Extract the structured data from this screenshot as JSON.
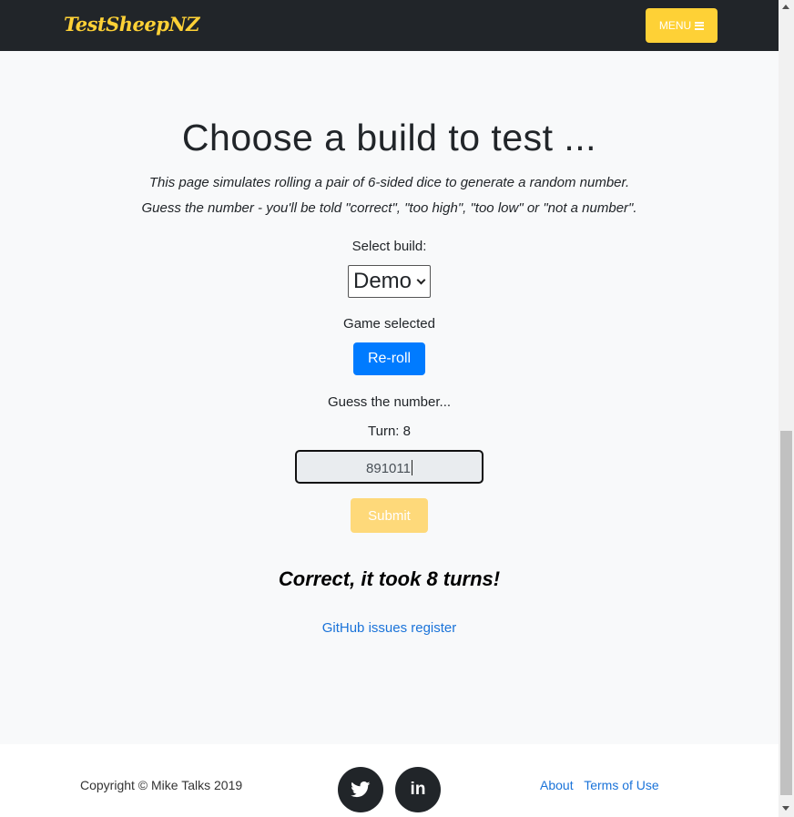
{
  "header": {
    "brand": "TestSheepNZ",
    "menu_label": "MENU"
  },
  "main": {
    "title": "Choose a build to test ...",
    "description_line1": "This page simulates rolling a pair of 6-sided dice to generate a random number.",
    "description_line2": "Guess the number - you'll be told \"correct\", \"too high\", \"too low\" or \"not a number\".",
    "select_build_label": "Select build:",
    "build_selected": "Demo",
    "game_status": "Game selected",
    "reroll_label": "Re-roll",
    "guess_prompt": "Guess the number...",
    "turn_text": "Turn: 8",
    "guess_value": "891011",
    "submit_label": "Submit",
    "result_text": "Correct, it took 8 turns!",
    "github_link": "GitHub issues register"
  },
  "footer": {
    "copyright": "Copyright © Mike Talks 2019",
    "social": [
      "twitter-icon",
      "linkedin-icon"
    ],
    "linkedin_glyph": "in",
    "links": [
      "About",
      "Terms of Use"
    ]
  },
  "colors": {
    "navbar": "#212529",
    "accent": "#fed136",
    "primary": "#007bff",
    "link": "#1a73d9"
  }
}
